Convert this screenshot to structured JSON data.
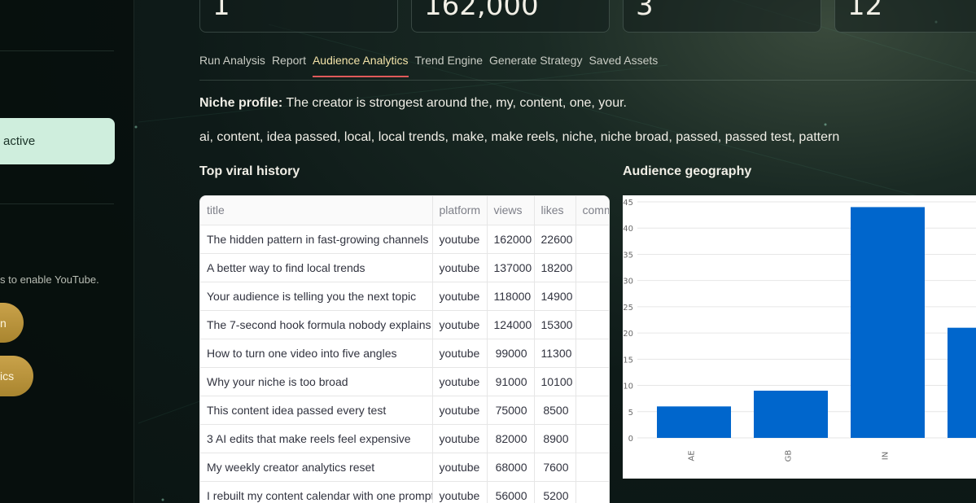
{
  "sidebar": {
    "active_label": "active",
    "note": "s to enable YouTube.",
    "button1_label": "n",
    "button2_label": "ics"
  },
  "stats": [
    "1",
    "162,000",
    "3",
    "12"
  ],
  "tabs": [
    {
      "label": "Run Analysis",
      "active": false
    },
    {
      "label": "Report",
      "active": false
    },
    {
      "label": "Audience Analytics",
      "active": true
    },
    {
      "label": "Trend Engine",
      "active": false
    },
    {
      "label": "Generate Strategy",
      "active": false
    },
    {
      "label": "Saved Assets",
      "active": false
    }
  ],
  "niche": {
    "label": "Niche profile:",
    "text": " The creator is strongest around the, my, content, one, your."
  },
  "tags": "ai, content, idea passed, local, local trends, make, make reels, niche, niche broad, passed, passed test, pattern",
  "viral": {
    "title": "Top viral history",
    "columns": [
      "title",
      "platform",
      "views",
      "likes",
      "comm"
    ],
    "rows": [
      [
        "The hidden pattern in fast-growing channels",
        "youtube",
        "162000",
        "22600"
      ],
      [
        "A better way to find local trends",
        "youtube",
        "137000",
        "18200"
      ],
      [
        "Your audience is telling you the next topic",
        "youtube",
        "118000",
        "14900"
      ],
      [
        "The 7-second hook formula nobody explains",
        "youtube",
        "124000",
        "15300"
      ],
      [
        "How to turn one video into five angles",
        "youtube",
        "99000",
        "11300"
      ],
      [
        "Why your niche is too broad",
        "youtube",
        "91000",
        "10100"
      ],
      [
        "This content idea passed every test",
        "youtube",
        "75000",
        "8500"
      ],
      [
        "3 AI edits that make reels feel expensive",
        "youtube",
        "82000",
        "8900"
      ],
      [
        "My weekly creator analytics reset",
        "youtube",
        "68000",
        "7600"
      ],
      [
        "I rebuilt my content calendar with one prompt",
        "youtube",
        "56000",
        "5200"
      ]
    ]
  },
  "geo": {
    "title": "Audience geography"
  },
  "chart_data": {
    "type": "bar",
    "categories": [
      "AE",
      "GB",
      "IN",
      ""
    ],
    "values": [
      6,
      9,
      44,
      21
    ],
    "ylim": [
      0,
      45
    ],
    "yticks": [
      0,
      5,
      10,
      15,
      20,
      25,
      30,
      35,
      40,
      45
    ],
    "bar_color": "#0066cc",
    "grid": true
  },
  "colors": {
    "active_tab": "#f3e3a8",
    "tab_underline": "#e05a5a",
    "active_item_bg": "#cfeedd",
    "gold_button": "#c9a24a"
  }
}
